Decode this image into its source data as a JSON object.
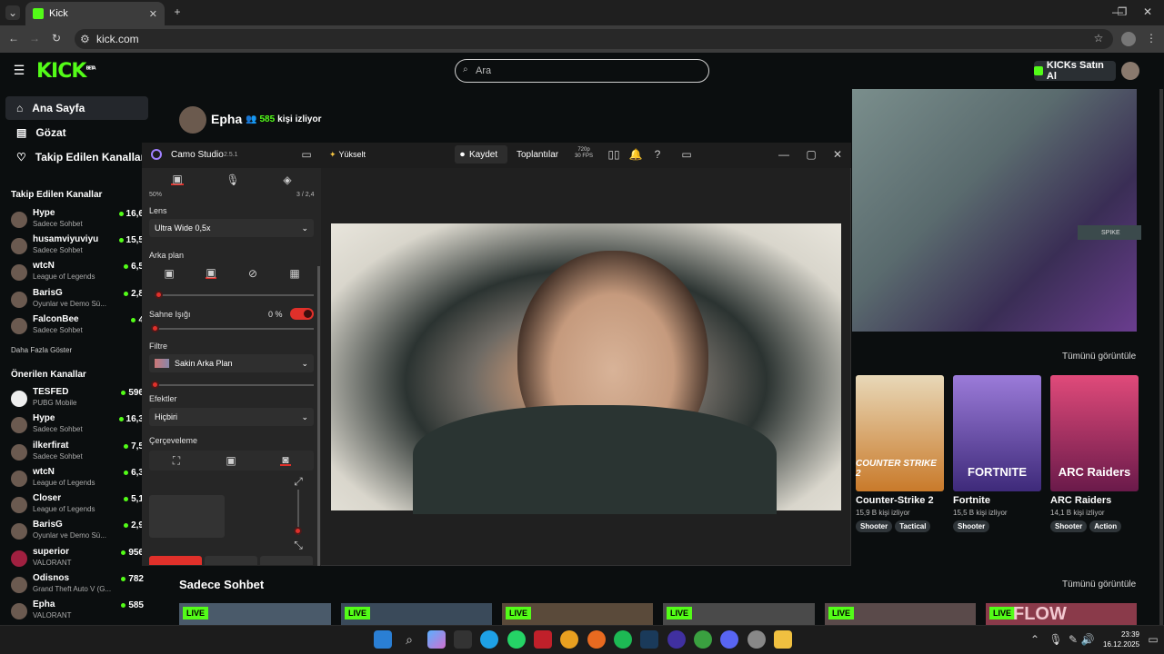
{
  "browser": {
    "tab_title": "Kick",
    "url": "kick.com"
  },
  "header": {
    "logo": "KICK",
    "beta": "BETA",
    "search_placeholder": "Ara",
    "kicks_button": "KICKs Satın Al"
  },
  "nav": [
    {
      "label": "Ana Sayfa"
    },
    {
      "label": "Gözat"
    },
    {
      "label": "Takip Edilen Kanallar"
    }
  ],
  "followed": {
    "title": "Takip Edilen Kanallar",
    "items": [
      {
        "name": "Hype",
        "game": "Sadece Sohbet",
        "viewers": "16,6"
      },
      {
        "name": "husamviyuviyu",
        "game": "Sadece Sohbet",
        "viewers": "15,5"
      },
      {
        "name": "wtcN",
        "game": "League of Legends",
        "viewers": "6,5"
      },
      {
        "name": "BarisG",
        "game": "Oyunlar ve Demo Sü...",
        "viewers": "2,8"
      },
      {
        "name": "FalconBee",
        "game": "Sadece Sohbet",
        "viewers": "4"
      }
    ],
    "more": "Daha Fazla Göster"
  },
  "recommended": {
    "title": "Önerilen Kanallar",
    "items": [
      {
        "name": "TESFED",
        "game": "PUBG Mobile",
        "viewers": "596"
      },
      {
        "name": "Hype",
        "game": "Sadece Sohbet",
        "viewers": "16,3"
      },
      {
        "name": "ilkerfirat",
        "game": "Sadece Sohbet",
        "viewers": "7,5"
      },
      {
        "name": "wtcN",
        "game": "League of Legends",
        "viewers": "6,3"
      },
      {
        "name": "Closer",
        "game": "League of Legends",
        "viewers": "5,1"
      },
      {
        "name": "BarisG",
        "game": "Oyunlar ve Demo Sü...",
        "viewers": "2,9"
      },
      {
        "name": "superior",
        "game": "VALORANT",
        "viewers": "956"
      },
      {
        "name": "Odisnos",
        "game": "Grand Theft Auto V (G...",
        "viewers": "782"
      },
      {
        "name": "Epha",
        "game": "VALORANT",
        "viewers": "585"
      }
    ]
  },
  "featured": {
    "name": "Epha",
    "viewers": "585",
    "viewers_label": "kişi izliyor",
    "spike": "SPIKE"
  },
  "categories": {
    "see_all": "Tümünü görüntüle",
    "items": [
      {
        "title": "Counter-Strike 2",
        "viewers": "15,9 B kişi izliyor",
        "tags": [
          "Shooter",
          "Tactical"
        ],
        "art": "COUNTER STRIKE 2",
        "color": "#d98a2b"
      },
      {
        "title": "Fortnite",
        "viewers": "15,5 B kişi izliyor",
        "tags": [
          "Shooter"
        ],
        "art": "FORTNITE",
        "color": "#6b4fc9"
      },
      {
        "title": "ARC Raiders",
        "viewers": "14,1 B kişi izliyor",
        "tags": [
          "Shooter",
          "Action"
        ],
        "art": "ARC Raiders",
        "color": "#c23a6a"
      }
    ]
  },
  "chat_section": {
    "title": "Sadece Sohbet",
    "see_all": "Tümünü görüntüle",
    "live": "LIVE",
    "flow": "FLOW"
  },
  "camo": {
    "title": "Camo Studio",
    "version": "2.5.1",
    "upgrade": "Yükselt",
    "record": "Kaydet",
    "meetings": "Toplantılar",
    "res": "720p",
    "fps": "30 FPS",
    "battery": "50%",
    "ratio": "3 / 2,4",
    "lens_label": "Lens",
    "lens_value": "Ultra Wide 0,5x",
    "bg_label": "Arka plan",
    "light_label": "Sahne Işığı",
    "light_value": "0 %",
    "filter_label": "Filtre",
    "filter_value": "Sakin Arka Plan",
    "effects_label": "Efektler",
    "effects_value": "Hiçbiri",
    "framing_label": "Çerçeveleme"
  },
  "taskbar": {
    "time": "23:39",
    "date": "16.12.2025"
  }
}
